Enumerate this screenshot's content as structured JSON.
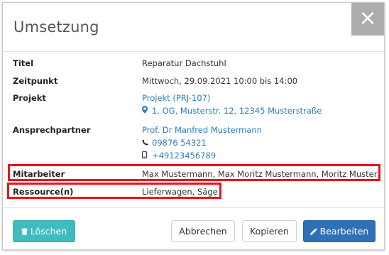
{
  "dialog": {
    "title": "Umsetzung",
    "close_glyph": "×"
  },
  "fields": {
    "titel": {
      "label": "Titel",
      "value": "Reparatur Dachstuhl"
    },
    "zeitpunkt": {
      "label": "Zeitpunkt",
      "value": "Mittwoch, 29.09.2021 10:00 bis 14:00"
    },
    "projekt": {
      "label": "Projekt",
      "value": "Projekt (PRJ-107)",
      "address": "1. OG, Musterstr. 12, 12345 Musterstraße",
      "address_icon": "map-marker-icon"
    },
    "ansprechpartner": {
      "label": "Ansprechpartner",
      "name": "Prof. Dr Manfred Mustermann",
      "phone": "09876 54321",
      "phone_icon": "phone-icon",
      "mobile": "+49123456789",
      "mobile_icon": "mobile-icon"
    },
    "mitarbeiter": {
      "label": "Mitarbeiter",
      "value": "Max Mustermann, Max Moritz Mustermann, Moritz Muster"
    },
    "ressourcen": {
      "label": "Ressource(n)",
      "value": "Lieferwagen, Säge"
    }
  },
  "buttons": {
    "delete": {
      "label": "Löschen",
      "icon": "trash-icon"
    },
    "cancel": {
      "label": "Abbrechen"
    },
    "copy": {
      "label": "Kopieren"
    },
    "edit": {
      "label": "Bearbeiten",
      "icon": "pencil-icon"
    }
  },
  "colors": {
    "link": "#2f7bbd",
    "highlight": "#e8141a",
    "delete_button": "#3fbcc0",
    "edit_button": "#2f70b8",
    "close_button": "#adadad"
  }
}
